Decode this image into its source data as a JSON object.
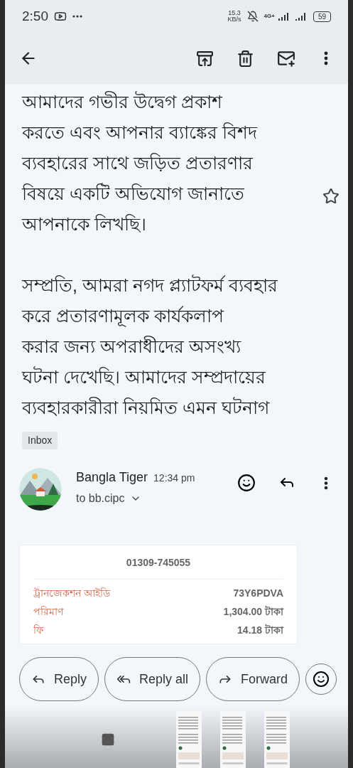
{
  "status_bar": {
    "time": "2:50",
    "speed_value": "15.3",
    "speed_unit": "KB/s",
    "network": "4G+",
    "battery": "59"
  },
  "body": {
    "paragraphs": [
      {
        "lines": [
          "আমাদের গভীর উদ্বেগ প্রকাশ",
          "করতে এবং আপনার ব্যাঙ্কের বিশদ",
          "ব্যবহারের সাথে জড়িত প্রতারণার",
          "বিষয়ে একটি অভিযোগ জানাতে",
          "আপনাকে লিখছি।"
        ]
      },
      {
        "lines": [
          "সম্প্রতি, আমরা নগদ প্ল্যাটফর্ম ব্যবহার",
          "করে প্রতারণামূলক কার্যকলাপ",
          "করার জন্য অপরাধীদের অসংখ্য",
          "ঘটনা দেখেছি। আমাদের সম্প্রদায়ের",
          "ব্যবহারকারীরা নিয়মিত এমন ঘটনাগ"
        ]
      }
    ],
    "starred": false
  },
  "label": "Inbox",
  "message": {
    "sender": "Bangla Tiger",
    "time": "12:34 pm",
    "recipient": "to bb.cipc"
  },
  "receipt": {
    "phone": "01309-745055",
    "rows": [
      {
        "label": "ট্রানজেকশন আইডি",
        "value": "73Y6PDVA"
      },
      {
        "label": "পরিমাণ",
        "value": "1,304.00 টাকা"
      },
      {
        "label": "ফি",
        "value": "14.18 টাকা"
      }
    ]
  },
  "actions": [
    {
      "kind": "reply",
      "label": "Reply"
    },
    {
      "kind": "reply_all",
      "label": "Reply all"
    },
    {
      "kind": "forward",
      "label": "Forward"
    }
  ]
}
